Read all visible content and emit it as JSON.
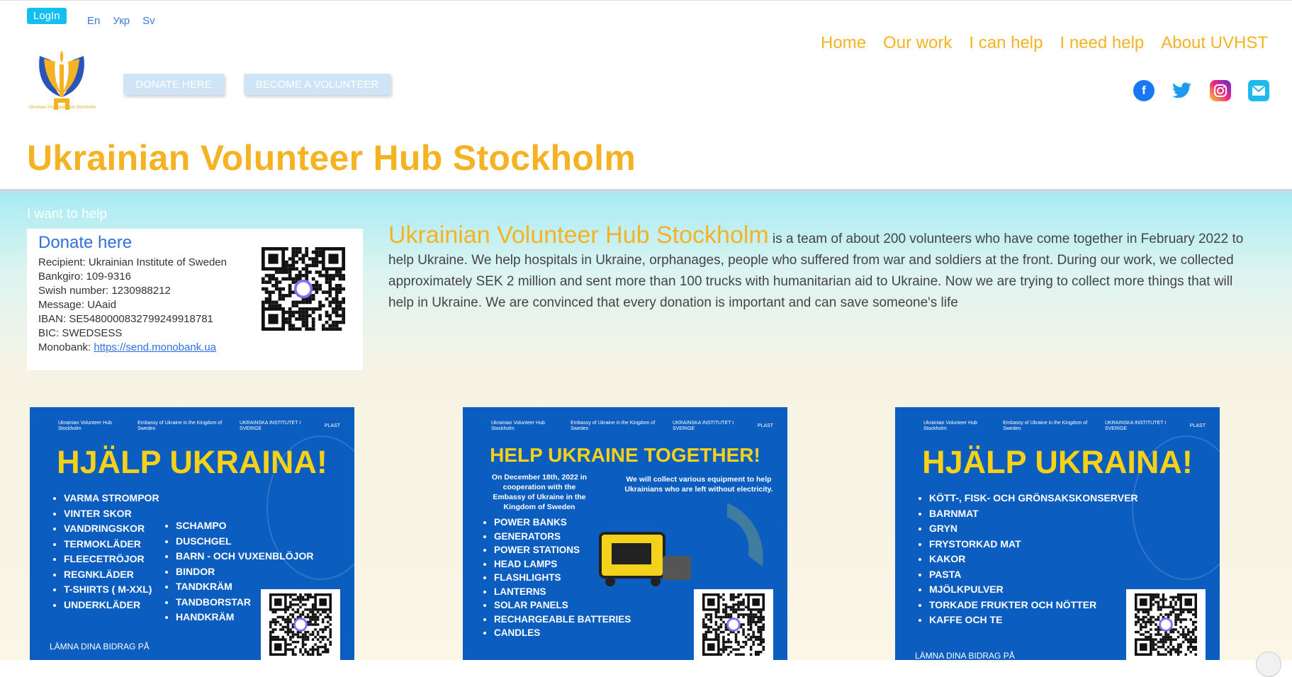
{
  "header": {
    "login_label": "LogIn",
    "languages": [
      "En",
      "Укр",
      "Sv"
    ],
    "logo_caption": "Ukrainian Volunteer Hub Stockholm",
    "donate_button": "DONATE HERE",
    "volunteer_button": "BECOME A VOLUNTEER",
    "nav": [
      "Home",
      "Our work",
      "I can help",
      "I need help",
      "About UVHST"
    ],
    "socials": [
      "facebook-icon",
      "twitter-icon",
      "instagram-icon",
      "mail-icon"
    ],
    "title": "Ukrainian Volunteer Hub Stockholm"
  },
  "main": {
    "want_help": "I want to help",
    "donate": {
      "title": "Donate here",
      "recipient": "Recipient: Ukrainian Institute of Sweden",
      "bankgiro": "Bankgiro: 109-9316",
      "swish": "Swish number: 1230988212",
      "message": "Message: UAaid",
      "iban": "IBAN: SE5480000832799249918781",
      "bic": "BIC: SWEDSESS",
      "monobank_label": "Monobank: ",
      "monobank_link": "https://send.monobank.ua"
    },
    "intro_title": "Ukrainian Volunteer Hub Stockholm",
    "intro_text": " is a team of about 200 volunteers who have come together in February 2022 to help Ukraine. We help hospitals in Ukraine, orphanages, people who suffered from war and soldiers at the front. During our work, we collected approximately SEK 2 million and sent more than 100 trucks with humanitarian aid to Ukraine. Now we are trying to collect more things that will help in Ukraine. We are convinced that every donation is important and can save someone's life"
  },
  "posters": {
    "header_labels": [
      "Ukrainian Volunteer Hub Stockholm",
      "Embassy of Ukraine in the Kingdom of Sweden",
      "UKRAINSKA INSTITUTET I SVERIGE",
      "PLAST"
    ],
    "p1": {
      "title": "HJÄLP UKRAINA!",
      "col1": [
        "VARMA STROMPOR",
        "VINTER SKOR",
        "VANDRINGSKOR",
        "TERMOKLÄDER",
        "FLEECETRÖJOR",
        "REGNKLÄDER",
        "T-SHIRTS ( M-XXL)",
        "UNDERKLÄDER"
      ],
      "col2": [
        "SCHAMPO",
        "DUSCHGEL",
        "BARN - OCH VUXENBLÖJOR",
        "BINDOR",
        "TANDKRÄM",
        "TANDBORSTAR",
        "HANDKRÄM"
      ],
      "footer": "LÄMNA DINA BIDRAG PÅ"
    },
    "p2": {
      "title": "HELP UKRAINE TOGETHER!",
      "note_left": "On December 18th, 2022 in cooperation with the Embassy of Ukraine in the Kingdom of Sweden",
      "note_right": "We will collect various equipment to help Ukrainians who are left without electricity.",
      "items": [
        "POWER BANKS",
        "GENERATORS",
        "POWER STATIONS",
        "HEAD LAMPS",
        "FLASHLIGHTS",
        "LANTERNS",
        "SOLAR PANELS",
        "RECHARGEABLE BATTERIES",
        "CANDLES"
      ]
    },
    "p3": {
      "title": "HJÄLP UKRAINA!",
      "items": [
        "KÖTT-, FISK- OCH GRÖNSAKSKONSERVER",
        "BARNMAT",
        "GRYN",
        "FRYSTORKAD MAT",
        "KAKOR",
        "PASTA",
        "MJÖLKPULVER",
        "TORKADE FRUKTER OCH NÖTTER",
        "KAFFE  OCH TE"
      ],
      "footer": "LÄMNA DINA BIDRAG PÅ"
    }
  },
  "colors": {
    "accent": "#f5b324",
    "link": "#2f6fe0",
    "login": "#12bff0",
    "poster_blue": "#0b5dbf",
    "poster_yellow": "#f7d117"
  }
}
